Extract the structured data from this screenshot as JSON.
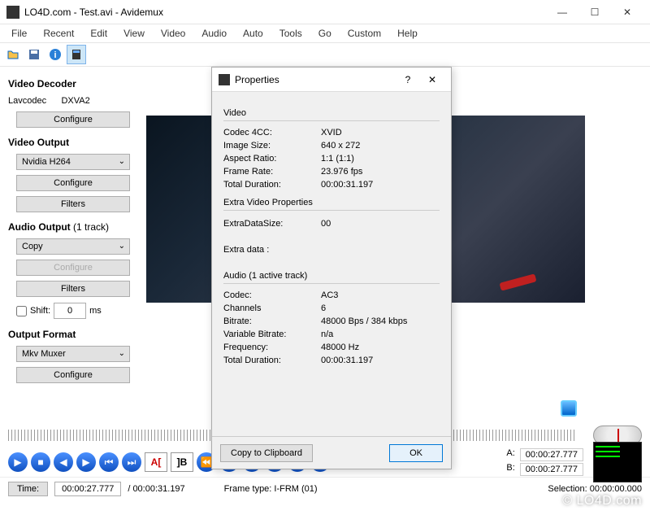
{
  "window": {
    "title": "LO4D.com - Test.avi - Avidemux"
  },
  "menu": [
    "File",
    "Recent",
    "Edit",
    "View",
    "Video",
    "Audio",
    "Auto",
    "Tools",
    "Go",
    "Custom",
    "Help"
  ],
  "sidebar": {
    "decoder_title": "Video Decoder",
    "decoder_codec": "Lavcodec",
    "decoder_accel": "DXVA2",
    "configure": "Configure",
    "video_output_title": "Video Output",
    "video_output_value": "Nvidia H264",
    "filters": "Filters",
    "audio_output_title": "Audio Output",
    "audio_output_tracks": "(1 track)",
    "audio_output_value": "Copy",
    "shift_label": "Shift:",
    "shift_value": "0",
    "shift_unit": "ms",
    "output_format_title": "Output Format",
    "output_format_value": "Mkv Muxer"
  },
  "dialog": {
    "title": "Properties",
    "video_section": "Video",
    "codec4cc_k": "Codec 4CC:",
    "codec4cc_v": "XVID",
    "imgsize_k": "Image Size:",
    "imgsize_v": "640 x 272",
    "aspect_k": "Aspect Ratio:",
    "aspect_v": "1:1 (1:1)",
    "fps_k": "Frame Rate:",
    "fps_v": "23.976 fps",
    "dur_k": "Total Duration:",
    "dur_v": "00:00:31.197",
    "extra_section": "Extra Video Properties",
    "extrasize_k": "ExtraDataSize:",
    "extrasize_v": "00",
    "extradata_k": "Extra data :",
    "audio_section": "Audio (1 active track)",
    "acodec_k": "Codec:",
    "acodec_v": "AC3",
    "channels_k": "Channels",
    "channels_v": "6",
    "bitrate_k": "Bitrate:",
    "bitrate_v": "48000 Bps / 384 kbps",
    "vbr_k": "Variable Bitrate:",
    "vbr_v": "n/a",
    "freq_k": "Frequency:",
    "freq_v": "48000 Hz",
    "adur_k": "Total Duration:",
    "adur_v": "00:00:31.197",
    "copy_btn": "Copy to Clipboard",
    "ok_btn": "OK"
  },
  "timeline": {
    "a_label": "A:",
    "a_value": "00:00:27.777",
    "b_label": "B:",
    "b_value": "00:00:27.777"
  },
  "bottom": {
    "time_label": "Time:",
    "time_value": "00:00:27.777",
    "duration": "/ 00:00:31.197",
    "frame_type": "Frame type:  I-FRM (01)",
    "selection": "Selection: 00:00:00.000"
  },
  "watermark": "© LO4D.com"
}
